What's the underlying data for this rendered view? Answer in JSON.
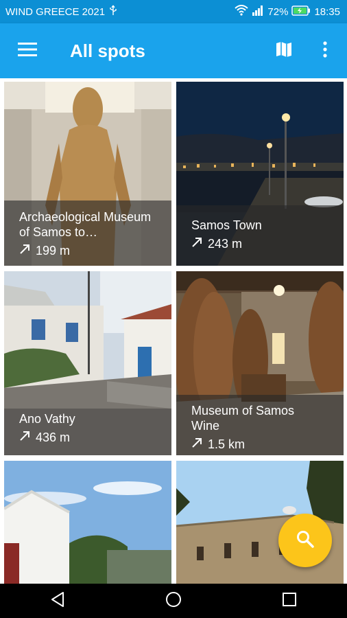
{
  "status": {
    "carrier": "WIND GREECE 2021",
    "battery": "72%",
    "time": "18:35"
  },
  "appbar": {
    "title": "All spots",
    "icons": [
      "menu-icon",
      "map-icon",
      "more-vert-icon"
    ]
  },
  "spots": [
    {
      "name": "Archaeological Museum of Samos to…",
      "distance": "199 m"
    },
    {
      "name": "Samos Town",
      "distance": "243 m"
    },
    {
      "name": "Ano Vathy",
      "distance": "436 m"
    },
    {
      "name": "Museum of Samos Wine",
      "distance": "1.5 km"
    }
  ],
  "fab": {
    "icon": "search-icon",
    "color": "#fcc51a"
  },
  "colors": {
    "appbar": "#1aa3ec",
    "statusbar": "#0c8fd4"
  }
}
